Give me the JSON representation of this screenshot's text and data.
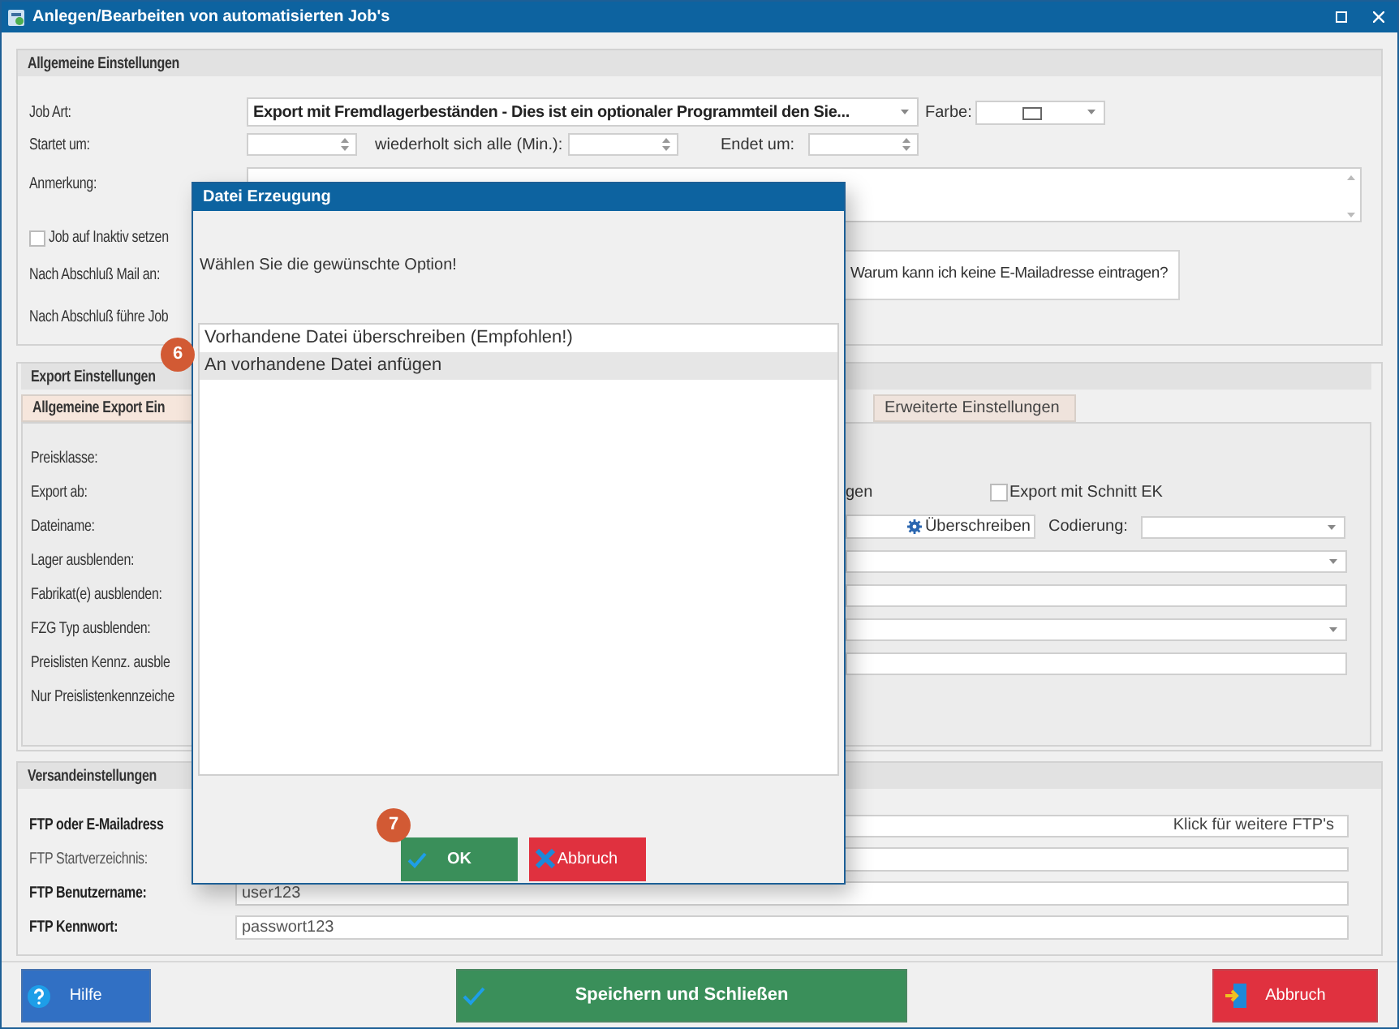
{
  "window": {
    "title": "Anlegen/Bearbeiten von automatisierten Job's"
  },
  "general": {
    "title": "Allgemeine Einstellungen",
    "job_art": {
      "label": "Job Art:",
      "value": "Export mit Fremdlagerbeständen - Dies ist ein optionaler Programmteil den Sie..."
    },
    "farbe": {
      "label": "Farbe:"
    },
    "startet_um": {
      "label": "Startet um:"
    },
    "wiederholt": {
      "label": "wiederholt sich alle (Min.):"
    },
    "endet_um": {
      "label": "Endet um:"
    },
    "anmerkung": {
      "label": "Anmerkung:"
    },
    "inaktiv": {
      "label": "Job auf Inaktiv setzen",
      "checked": false
    },
    "mail": {
      "label": "Nach Abschluß Mail an:",
      "help_button": "Warum kann ich keine E-Mailadresse eintragen?"
    },
    "follow_job": {
      "label": "Nach Abschluß führe Job"
    }
  },
  "export": {
    "title": "Export Einstellungen",
    "tabs": [
      {
        "label": "Allgemeine Export Ein",
        "selected": true
      },
      {
        "label": "Erweiterte Einstellungen",
        "selected": false
      }
    ],
    "rows": [
      {
        "label": "Preisklasse:",
        "kind": "plain"
      },
      {
        "label": "Export ab:",
        "kind": "export_ab",
        "text": "gen",
        "checkbox": {
          "label": "Export mit Schnitt EK",
          "checked": false
        }
      },
      {
        "label": "Dateiname:",
        "kind": "dateiname",
        "button": "Überschreiben",
        "codierung": "Codierung:"
      },
      {
        "label": "Lager ausblenden:",
        "kind": "select"
      },
      {
        "label": "Fabrikat(e) ausblenden:",
        "kind": "field"
      },
      {
        "label": "FZG Typ  ausblenden:",
        "kind": "select"
      },
      {
        "label": "Preislisten Kennz. ausble",
        "kind": "field"
      },
      {
        "label": "Nur Preislistenkennzeiche",
        "kind": "plain"
      }
    ]
  },
  "shipping": {
    "title": "Versandeinstellungen",
    "rows": [
      {
        "label": "FTP oder E-Mailadress",
        "bold": true,
        "kind": "ftp_list",
        "hint": "Klick für weitere FTP's"
      },
      {
        "label": "FTP Startverzeichnis:",
        "bold": false,
        "kind": "field"
      },
      {
        "label": "FTP Benutzername:",
        "bold": true,
        "kind": "field",
        "value": "user123"
      },
      {
        "label": "FTP Kennwort:",
        "bold": true,
        "kind": "field",
        "value": "passwort123"
      }
    ]
  },
  "footer_buttons": [
    {
      "label": "Hilfe",
      "kind": "help"
    },
    {
      "label": "Speichern und Schließen",
      "kind": "save"
    },
    {
      "label": "Abbruch",
      "kind": "cancel"
    }
  ],
  "dialog": {
    "title": "Datei Erzeugung",
    "prompt": "Wählen Sie die gewünschte Option!",
    "options": [
      {
        "label": "Vorhandene Datei überschreiben (Empfohlen!)",
        "selected": false
      },
      {
        "label": "An vorhandene Datei anfügen",
        "selected": true
      }
    ],
    "buttons": [
      {
        "label": "OK",
        "kind": "ok"
      },
      {
        "label": "Abbruch",
        "kind": "cancel"
      }
    ]
  },
  "badges": [
    {
      "label": "6"
    },
    {
      "label": "7"
    }
  ]
}
